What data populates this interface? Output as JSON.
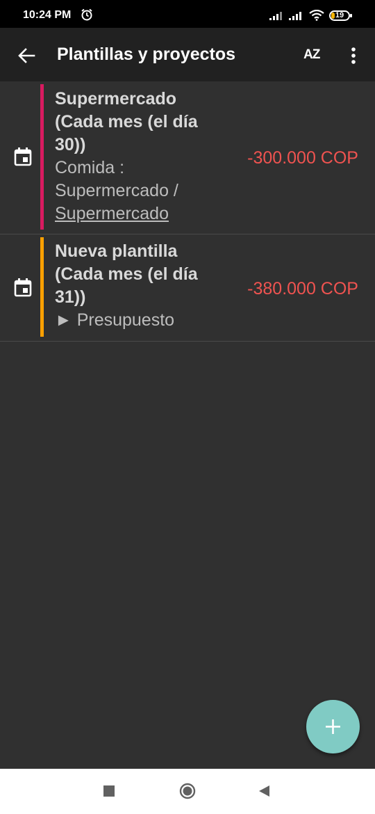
{
  "status_bar": {
    "time": "10:24 PM",
    "battery_level": "19"
  },
  "app_bar": {
    "title": "Plantillas y proyectos",
    "sort_label": "AZ"
  },
  "items": [
    {
      "title": "Supermercado (Cada mes (el día 30))",
      "category": "Comida : Supermercado / ",
      "category_link": "Supermercado",
      "amount": "-300.000 COP",
      "stripe_color": "#d81b60"
    },
    {
      "title": "Nueva plantilla (Cada mes (el día 31))",
      "subtitle": "► Presupuesto",
      "amount": "-380.000 COP",
      "stripe_color": "#ffa000"
    }
  ],
  "colors": {
    "amount": "#ef5350",
    "fab": "#80cbc4",
    "background": "#303030",
    "app_bar": "#212121"
  }
}
